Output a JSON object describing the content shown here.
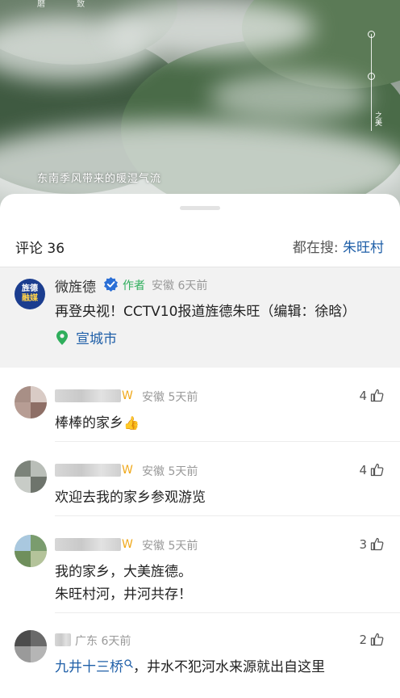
{
  "video": {
    "top_text": "磨 致",
    "caption": "东南季风带来的暖湿气流",
    "side_text": "之美"
  },
  "sheet": {
    "comments_label": "评论 36",
    "search_prefix": "都在搜:",
    "search_keyword": "朱旺村",
    "search_icon": "search-icon"
  },
  "author_post": {
    "avatar_line1": "旌德",
    "avatar_line2": "融媒",
    "name": "微旌德",
    "tag": "作者",
    "meta": "安徽 6天前",
    "text": "再登央视！CCTV10报道旌德朱旺（编辑：徐晗）",
    "location": "宣城市",
    "accent_color": "#1f5fa8"
  },
  "comments": [
    {
      "meta": "安徽 5天前",
      "likes": "4",
      "body": "棒棒的家乡",
      "emoji": "👍"
    },
    {
      "meta": "安徽 5天前",
      "likes": "4",
      "body": "欢迎去我的家乡参观游览"
    },
    {
      "meta": "安徽 5天前",
      "likes": "3",
      "body_line1": "我的家乡，大美旌德。",
      "body_line2": "朱旺村河，井河共存！"
    },
    {
      "meta": "广东 6天前",
      "likes": "2",
      "topic": "九井十三桥",
      "body": "，井水不犯河水来源就出自这里"
    }
  ],
  "badge_glyph": "W"
}
